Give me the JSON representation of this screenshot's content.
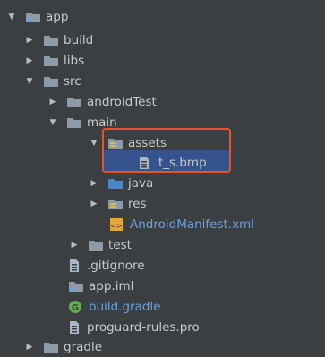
{
  "tree": [
    {
      "label": "app",
      "expanded": true,
      "icon": "module-folder-icon",
      "color": "#c8cbce"
    },
    {
      "label": "build",
      "expanded": false,
      "icon": "folder-icon",
      "color": "#c8cbce"
    },
    {
      "label": "libs",
      "expanded": false,
      "icon": "folder-icon",
      "color": "#c8cbce"
    },
    {
      "label": "src",
      "expanded": true,
      "icon": "folder-icon",
      "color": "#c8cbce"
    },
    {
      "label": "androidTest",
      "expanded": false,
      "icon": "folder-icon",
      "color": "#c8cbce"
    },
    {
      "label": "main",
      "expanded": true,
      "icon": "folder-icon",
      "color": "#c8cbce"
    },
    {
      "label": "assets",
      "expanded": true,
      "icon": "assets-folder-icon",
      "color": "#c8cbce"
    },
    {
      "label": "t_s.bmp",
      "expanded": null,
      "icon": "image-file-icon",
      "color": "#c8cbce"
    },
    {
      "label": "java",
      "expanded": false,
      "icon": "source-folder-icon",
      "color": "#c8cbce"
    },
    {
      "label": "res",
      "expanded": false,
      "icon": "resource-folder-icon",
      "color": "#c8cbce"
    },
    {
      "label": "AndroidManifest.xml",
      "expanded": null,
      "icon": "xml-file-icon",
      "color": "#6aa1e0"
    },
    {
      "label": "test",
      "expanded": false,
      "icon": "folder-icon",
      "color": "#c8cbce"
    },
    {
      "label": ".gitignore",
      "expanded": null,
      "icon": "text-file-icon",
      "color": "#c8cbce"
    },
    {
      "label": "app.iml",
      "expanded": null,
      "icon": "iml-file-icon",
      "color": "#c8cbce"
    },
    {
      "label": "build.gradle",
      "expanded": null,
      "icon": "gradle-file-icon",
      "color": "#6aa1e0"
    },
    {
      "label": "proguard-rules.pro",
      "expanded": null,
      "icon": "text-file-icon",
      "color": "#c8cbce"
    },
    {
      "label": "gradle",
      "expanded": false,
      "icon": "folder-icon",
      "color": "#c8cbce"
    }
  ],
  "colors": {
    "background": "#3c3f41",
    "highlight_border": "#e8542a",
    "selection": "#2f65ca"
  }
}
